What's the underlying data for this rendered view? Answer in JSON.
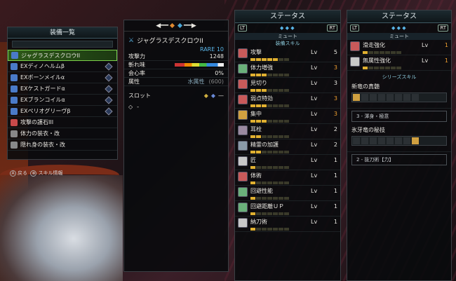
{
  "equip_list": {
    "title": "装備一覧",
    "items": [
      {
        "name": "ジャグラスデスクロウII",
        "selected": true,
        "color": "#4a7ac8"
      },
      {
        "name": "EXディノヘルムβ",
        "color": "#4a7ac8"
      },
      {
        "name": "EXボーンメイルα",
        "color": "#4a7ac8"
      },
      {
        "name": "EXケストガードα",
        "color": "#4a7ac8"
      },
      {
        "name": "EXブランコイルα",
        "color": "#4a7ac8"
      },
      {
        "name": "EXペリオグリーヴβ",
        "color": "#4a7ac8"
      },
      {
        "name": "攻撃の護石III",
        "color": "#c84a4a"
      },
      {
        "name": "体力の装衣・改",
        "color": "#888"
      },
      {
        "name": "隠れ身の装衣・改",
        "color": "#888"
      }
    ],
    "hint_back": "戻る",
    "hint_info": "スキル情報"
  },
  "detail": {
    "name": "ジャグラスデスクロウII",
    "rarity": "RARE 10",
    "attack_label": "攻撃力",
    "attack": "1248",
    "sharpness_label": "斬れ味",
    "affinity_label": "会心率",
    "affinity": "0%",
    "element_label": "属性",
    "element_type": "水属性",
    "element_value": "(600)",
    "slot_label": "スロット",
    "defense_label": "-"
  },
  "status1": {
    "title": "ステータス",
    "mute": "ミュート",
    "section": "装備スキル",
    "skills": [
      {
        "name": "攻撃",
        "lv": "5",
        "hi": false,
        "color": "#c85a5a"
      },
      {
        "name": "体力増強",
        "lv": "3",
        "hi": true,
        "color": "#6ab07a"
      },
      {
        "name": "見切り",
        "lv": "3",
        "hi": false,
        "color": "#c85a5a"
      },
      {
        "name": "弱点特効",
        "lv": "3",
        "hi": true,
        "color": "#c85a5a"
      },
      {
        "name": "集中",
        "lv": "3",
        "hi": true,
        "color": "#d0a040"
      },
      {
        "name": "耳栓",
        "lv": "2",
        "hi": false,
        "color": "#9a8aa0"
      },
      {
        "name": "精霊の加護",
        "lv": "2",
        "hi": false,
        "color": "#8a9aa8"
      },
      {
        "name": "匠",
        "lv": "1",
        "hi": false,
        "color": "#c8c8c8"
      },
      {
        "name": "体術",
        "lv": "1",
        "hi": false,
        "color": "#c85a5a"
      },
      {
        "name": "回避性能",
        "lv": "1",
        "hi": false,
        "color": "#6ab07a"
      },
      {
        "name": "回避距離ＵＰ",
        "lv": "1",
        "hi": false,
        "color": "#6ab07a"
      },
      {
        "name": "納刀術",
        "lv": "1",
        "hi": false,
        "color": "#c8c8c8"
      }
    ]
  },
  "status2": {
    "title": "ステータス",
    "mute": "ミュート",
    "skills": [
      {
        "name": "滑走強化",
        "lv": "1",
        "hi": true,
        "color": "#c85a5a"
      },
      {
        "name": "無属性強化",
        "lv": "1",
        "hi": true,
        "color": "#c8c8c8"
      }
    ],
    "series_section": "シリーズスキル",
    "series": [
      {
        "name": "新竜の真髄",
        "bonus": "3 - 渾身・極意"
      },
      {
        "name": "氷牙竜の秘技",
        "bonus": "2 - 抜刀術【力】"
      }
    ]
  },
  "ui": {
    "lv_label": "Lv",
    "lt": "LT",
    "rt": "RT"
  }
}
